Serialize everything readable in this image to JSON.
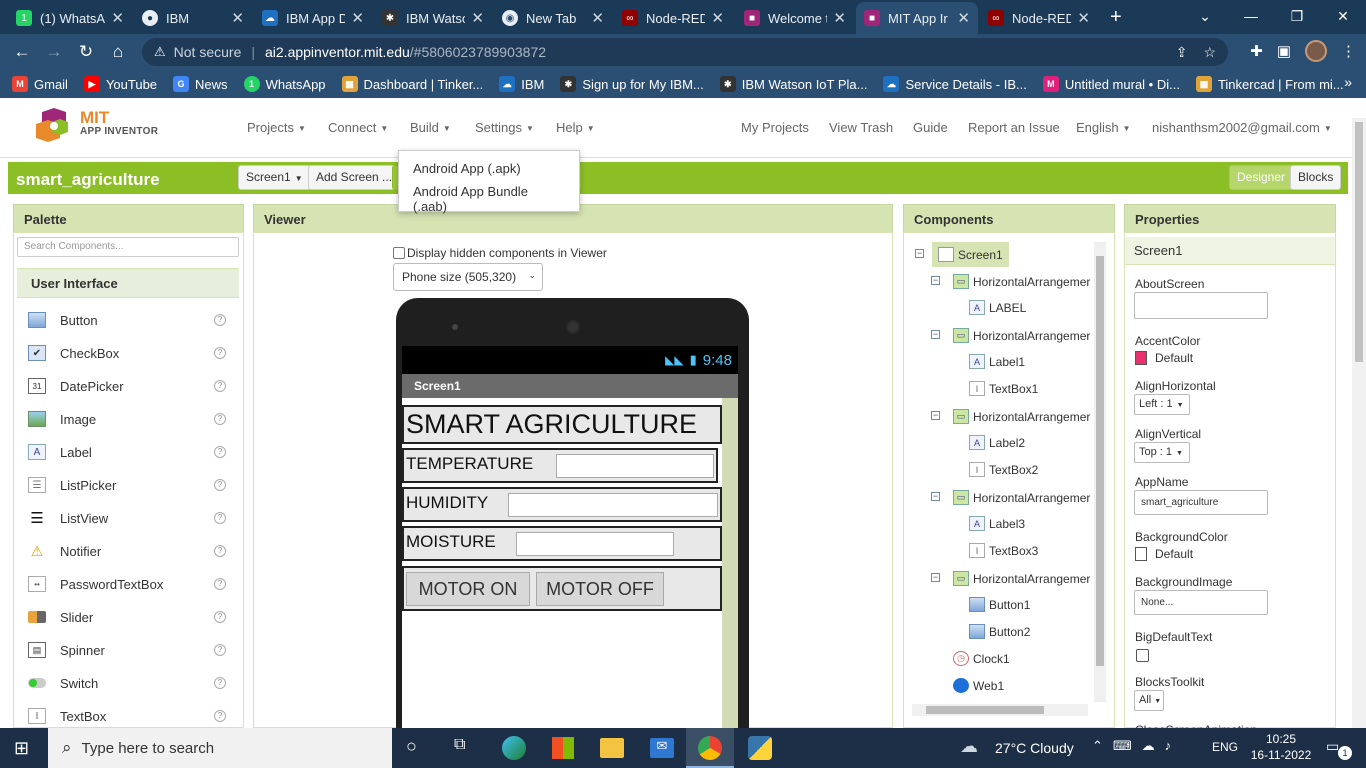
{
  "browser": {
    "tabs": [
      {
        "title": "(1) WhatsA",
        "icon": "whatsapp-icon",
        "color": "#25d366"
      },
      {
        "title": "IBM",
        "icon": "globe-icon",
        "color": "#5f6368"
      },
      {
        "title": "IBM App D",
        "icon": "ibm-cloud-icon",
        "color": "#1f70c1"
      },
      {
        "title": "IBM Watso",
        "icon": "watson-icon",
        "color": "#333333"
      },
      {
        "title": "New Tab",
        "icon": "chrome-icon",
        "color": "#5f6368"
      },
      {
        "title": "Node-RED",
        "icon": "node-red-icon",
        "color": "#8f0000"
      },
      {
        "title": "Welcome t",
        "icon": "app-inventor-icon",
        "color": "#a0267a"
      },
      {
        "title": "MIT App Ir",
        "icon": "app-inventor-icon",
        "color": "#a0267a"
      },
      {
        "title": "Node-RED",
        "icon": "node-red-icon",
        "color": "#8f0000"
      }
    ],
    "new_tab": "+",
    "address": {
      "status": "Not secure",
      "host": "ai2.appinventor.mit.edu",
      "path": "/#5806023789903872"
    },
    "bookmarks": [
      {
        "label": "Gmail",
        "icon": "gmail-icon",
        "color": "#ea4335"
      },
      {
        "label": "YouTube",
        "icon": "youtube-icon",
        "color": "#ff0000"
      },
      {
        "label": "News",
        "icon": "news-icon",
        "color": "#4285f4"
      },
      {
        "label": "WhatsApp",
        "icon": "whatsapp-icon",
        "color": "#25d366"
      },
      {
        "label": "Dashboard | Tinker...",
        "icon": "tinkercad-icon",
        "color": "#e2a23a"
      },
      {
        "label": "IBM",
        "icon": "ibm-cloud-icon",
        "color": "#1f70c1"
      },
      {
        "label": "Sign up for My IBM...",
        "icon": "watson-icon",
        "color": "#333333"
      },
      {
        "label": "IBM Watson IoT Pla...",
        "icon": "watson-icon",
        "color": "#333333"
      },
      {
        "label": "Service Details - IB...",
        "icon": "ibm-cloud-icon",
        "color": "#1f70c1"
      },
      {
        "label": "Untitled mural • Di...",
        "icon": "mural-icon",
        "color": "#e0207a"
      },
      {
        "label": "Tinkercad | From mi...",
        "icon": "tinkercad-icon",
        "color": "#e2a23a"
      }
    ],
    "bookmarks_more": "»"
  },
  "app": {
    "logo_top": "MIT",
    "logo_bottom": "APP INVENTOR",
    "menus": [
      "Projects",
      "Connect",
      "Build",
      "Settings",
      "Help"
    ],
    "right_links": [
      "My Projects",
      "View Trash",
      "Guide",
      "Report an Issue",
      "English",
      "nishanthsm2002@gmail.com"
    ],
    "project_name": "smart_agriculture",
    "screen_button": "Screen1",
    "add_screen": "Add Screen ...",
    "designer": "Designer",
    "blocks": "Blocks",
    "build_menu": [
      "Android App (.apk)",
      "Android App Bundle (.aab)"
    ]
  },
  "palette": {
    "title": "Palette",
    "search_placeholder": "Search Components...",
    "category": "User Interface",
    "items": [
      "Button",
      "CheckBox",
      "DatePicker",
      "Image",
      "Label",
      "ListPicker",
      "ListView",
      "Notifier",
      "PasswordTextBox",
      "Slider",
      "Spinner",
      "Switch",
      "TextBox"
    ],
    "help_glyph": "?"
  },
  "viewer": {
    "title": "Viewer",
    "hidden_label": "Display hidden components in Viewer",
    "size_select": "Phone size (505,320)",
    "time": "9:48",
    "screen_title": "Screen1",
    "app_title": "SMART AGRICULTURE",
    "temperature": "TEMPERATURE",
    "humidity": "HUMIDITY",
    "moisture": "MOISTURE",
    "motor_on": "MOTOR ON",
    "motor_off": "MOTOR OFF"
  },
  "components": {
    "title": "Components",
    "root": "Screen1",
    "h1": "HorizontalArrangemer",
    "label": "LABEL",
    "h2": "HorizontalArrangemer",
    "label1": "Label1",
    "textbox1": "TextBox1",
    "h3": "HorizontalArrangemer",
    "label2": "Label2",
    "textbox2": "TextBox2",
    "h4": "HorizontalArrangemer",
    "label3": "Label3",
    "textbox3": "TextBox3",
    "h5": "HorizontalArrangemer",
    "button1": "Button1",
    "button2": "Button2",
    "clock1": "Clock1",
    "web1": "Web1"
  },
  "properties": {
    "title": "Properties",
    "screen": "Screen1",
    "about": "AboutScreen",
    "accent": "AccentColor",
    "accent_value": "Default",
    "accent_color": "#e8306e",
    "alignh": "AlignHorizontal",
    "alignh_value": "Left : 1",
    "alignv": "AlignVertical",
    "alignv_value": "Top : 1",
    "appname": "AppName",
    "appname_value": "smart_agriculture",
    "bgcolor": "BackgroundColor",
    "bgcolor_value": "Default",
    "bgimage": "BackgroundImage",
    "bgimage_value": "None...",
    "bigtext": "BigDefaultText",
    "toolkit": "BlocksToolkit",
    "toolkit_value": "All",
    "cutoff": "CloseScreenAnimation"
  },
  "taskbar": {
    "search_placeholder": "Type here to search",
    "weather": "27°C  Cloudy",
    "lang": "ENG",
    "time": "10:25",
    "date": "16-11-2022",
    "notifications": "1"
  },
  "colors": {
    "chrome_dark": "#1b3a57",
    "chrome_mid": "#2b4f73",
    "ai_green": "#8cbf26",
    "panel_head": "#d6e4b4"
  }
}
